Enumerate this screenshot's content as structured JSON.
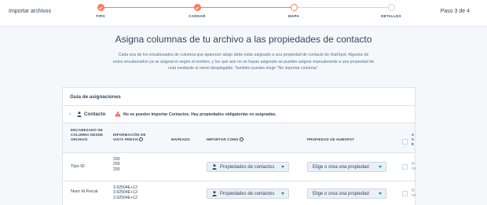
{
  "header": {
    "import_label": "Importar archivos",
    "step_counter": "Paso 3 de 4",
    "steps": [
      {
        "label": "TIPO",
        "state": "done"
      },
      {
        "label": "CARGAR",
        "state": "done"
      },
      {
        "label": "MAPA",
        "state": "current"
      },
      {
        "label": "DETALLES",
        "state": "todo"
      }
    ]
  },
  "main": {
    "title": "Asigna columnas de tu archivo a las propiedades de contacto",
    "description": "Cada una de los encabezados de columna que aparecen abajo debe estar asignado a una propiedad de contacto de HubSpot. Algunos de estos encabezados ya se asignaron según el nombre, y los que aún no se hayan asignado se pueden asignar manualmente a una propiedad de nota mediante el menú desplegable. También puedes elegir \"No importar columna\"."
  },
  "guide": {
    "title": "Guía de asignaciones",
    "object_label": "Contacto",
    "warning": "No se pueden importar Contactos. Hay propiedades obligatorias no asignadas."
  },
  "table": {
    "headers": {
      "column": "ENCABEZADO DE COLUMNA DESDE ARCHIVO",
      "preview": "INFORMACIÓN DE VISTA PREVIA",
      "mapped": "MAPEADO",
      "import_as": "IMPORTAR COMO",
      "hubspot_property": "PROPIEDAD DE HUBSPOT",
      "truncated": "A V E"
    },
    "rows": [
      {
        "column": "Tipo ID",
        "preview": [
          "200",
          "200",
          "200"
        ],
        "import_as": "Propiedades de contactos",
        "property": "Elige o crea una propiedad",
        "truncated": "N no"
      },
      {
        "column": "Num Id Fiscal",
        "preview": [
          "3.92504E+12",
          "3.92504E+12",
          "3.92504E+12"
        ],
        "import_as": "Propiedades de contactos",
        "property": "Elige o crea una propiedad",
        "truncated": "N no"
      }
    ]
  },
  "colors": {
    "accent": "#ff7a59",
    "link": "#0091ae",
    "warning": "#f2545b"
  },
  "icons": {
    "check": "check-icon",
    "person": "person-icon",
    "warning": "warning-icon",
    "chevron": "chevron-right-icon",
    "info": "info-icon",
    "caret": "caret-down-icon"
  }
}
